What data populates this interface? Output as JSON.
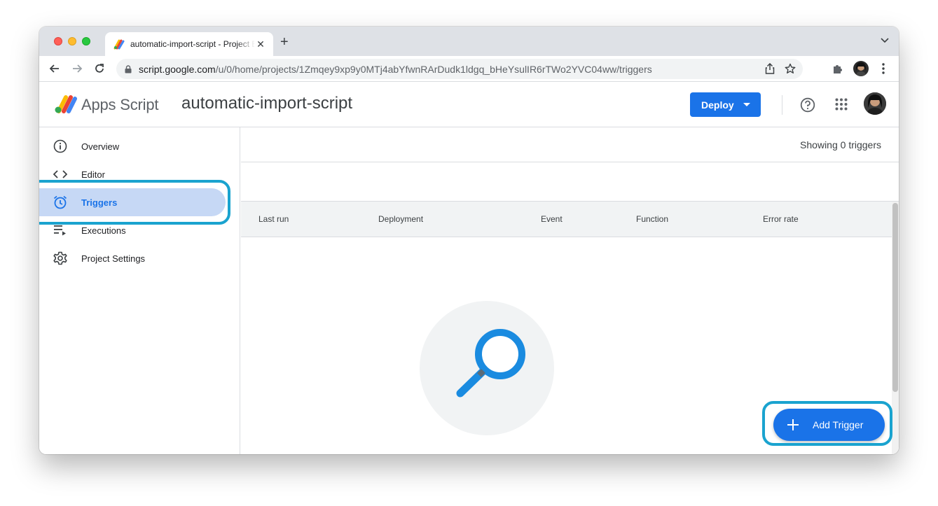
{
  "browser": {
    "tab_title": "automatic-import-script - Project Editor - Apps Script",
    "url_host": "script.google.com",
    "url_path": "/u/0/home/projects/1Zmqey9xp9y0MTj4abYfwnRArDudk1ldgq_bHeYsulIR6rTWo2YVC04ww/triggers"
  },
  "header": {
    "product_name": "Apps Script",
    "project_name": "automatic-import-script",
    "deploy_label": "Deploy"
  },
  "sidebar": {
    "items": [
      {
        "label": "Overview",
        "icon": "info-icon"
      },
      {
        "label": "Editor",
        "icon": "code-icon"
      },
      {
        "label": "Triggers",
        "icon": "alarm-clock-icon",
        "active": true
      },
      {
        "label": "Executions",
        "icon": "executions-list-icon"
      },
      {
        "label": "Project Settings",
        "icon": "gear-icon"
      }
    ]
  },
  "main": {
    "count_text": "Showing 0 triggers",
    "columns": [
      "Last run",
      "Deployment",
      "Event",
      "Function",
      "Error rate"
    ],
    "add_trigger_label": "Add Trigger"
  },
  "colors": {
    "accent": "#1a73e8",
    "active_nav_bg": "#c6d8f5",
    "highlight_ring": "#1aa3cf"
  }
}
